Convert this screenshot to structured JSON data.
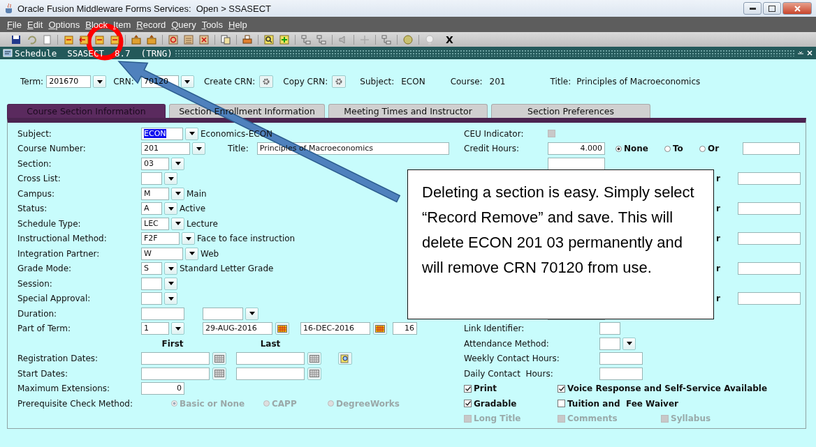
{
  "window": {
    "title": "Oracle Fusion Middleware Forms Services:  Open > SSASECT"
  },
  "menu": [
    {
      "label": "File"
    },
    {
      "label": "Edit"
    },
    {
      "label": "Options"
    },
    {
      "label": "Block"
    },
    {
      "label": "Item"
    },
    {
      "label": "Record"
    },
    {
      "label": "Query"
    },
    {
      "label": "Tools"
    },
    {
      "label": "Help"
    }
  ],
  "toolbar": {
    "close_label": "X"
  },
  "form": {
    "title": "Schedule  SSASECT  8.7  (TRNG)"
  },
  "key_block": {
    "term": {
      "label": "Term:",
      "value": "201670"
    },
    "crn": {
      "label": "CRN:",
      "value": "70120"
    },
    "create_crn": {
      "label": "Create CRN:"
    },
    "copy_crn": {
      "label": "Copy CRN:"
    },
    "subject": {
      "label": "Subject:",
      "value": "ECON"
    },
    "course": {
      "label": "Course:",
      "value": "201"
    },
    "title": {
      "label": "Title:",
      "value": "Principles of Macroeconomics"
    }
  },
  "tabs": [
    {
      "label": "Course Section Information",
      "selected": true
    },
    {
      "label": "Section Enrollment Information",
      "selected": false
    },
    {
      "label": "Meeting Times and Instructor",
      "selected": false
    },
    {
      "label": "Section Preferences",
      "selected": false
    }
  ],
  "left_rows": [
    {
      "kind": "select",
      "label": "Subject:",
      "value": "ECON",
      "value_selected": true,
      "description": "Economics-ECON"
    },
    {
      "kind": "course",
      "label": "Course Number:",
      "value": "201",
      "title_label": "Title:",
      "title_value": "Principles of Macroeconomics"
    },
    {
      "kind": "select",
      "label": "Section:",
      "value": "03"
    },
    {
      "kind": "select",
      "label": "Cross List:"
    },
    {
      "kind": "select",
      "label": "Campus:",
      "value": "M",
      "description": "Main"
    },
    {
      "kind": "select",
      "label": "Status:",
      "value": "A",
      "description": "Active"
    },
    {
      "kind": "select",
      "label": "Schedule Type:",
      "value": "LEC",
      "description": "Lecture"
    },
    {
      "kind": "select",
      "label": "Instructional Method:",
      "value": "F2F",
      "description": "Face to face instruction"
    },
    {
      "kind": "select",
      "label": "Integration Partner:",
      "value": "W",
      "description": "Web"
    },
    {
      "kind": "select",
      "label": "Grade Mode:",
      "value": "S",
      "description": "Standard Letter Grade"
    },
    {
      "kind": "select",
      "label": "Session:"
    },
    {
      "kind": "select",
      "label": "Special Approval:"
    },
    {
      "kind": "duration",
      "label": "Duration:"
    },
    {
      "kind": "term_part",
      "label": "Part of Term:",
      "value": "1",
      "start": "29-AUG-2016",
      "end": "16-DEC-2016",
      "weeks": "16"
    },
    {
      "kind": "header",
      "first": "First",
      "last": "Last"
    },
    {
      "kind": "dates",
      "label": "Registration Dates:",
      "lookup": true
    },
    {
      "kind": "dates",
      "label": "Start Dates:",
      "lookup": false
    },
    {
      "kind": "number",
      "label": "Maximum Extensions:",
      "value": "0"
    },
    {
      "kind": "radios",
      "label": "Prerequisite Check Method:",
      "options": [
        {
          "label": "Basic or None",
          "selected": true,
          "disabled": true
        },
        {
          "label": "CAPP",
          "selected": false,
          "disabled": true
        },
        {
          "label": "DegreeWorks",
          "selected": false,
          "disabled": true
        }
      ]
    }
  ],
  "right_rows": [
    {
      "kind": "checkbox",
      "label": "CEU Indicator:",
      "checked": false,
      "disabled": true
    },
    {
      "kind": "credit",
      "label": "Credit Hours:",
      "value": "4.000",
      "options": [
        {
          "label": "None",
          "selected": true
        },
        {
          "label": "To",
          "selected": false
        },
        {
          "label": "Or",
          "selected": false
        }
      ]
    },
    {
      "kind": "field"
    },
    {
      "kind": "or_field",
      "label": "r"
    },
    {
      "kind": "or_field",
      "label": "r"
    },
    {
      "kind": "or_field",
      "label": "r"
    },
    {
      "kind": "or_field",
      "label": "r"
    },
    {
      "kind": "or_field",
      "label": "r"
    },
    {
      "kind": "field"
    },
    {
      "kind": "input",
      "label": "Link Identifier:"
    },
    {
      "kind": "select",
      "label": "Attendance Method:"
    },
    {
      "kind": "input",
      "label": "Weekly Contact Hours:"
    },
    {
      "kind": "input",
      "label": "Daily Contact  Hours:"
    },
    {
      "kind": "checks",
      "items": [
        {
          "label": "Print",
          "checked": true,
          "disabled": false
        },
        {
          "label": "Voice Response and Self-Service Available",
          "checked": true,
          "disabled": false
        }
      ]
    },
    {
      "kind": "checks",
      "items": [
        {
          "label": "Gradable",
          "checked": true,
          "disabled": false
        },
        {
          "label": "Tuition and  Fee Waiver",
          "checked": false,
          "disabled": false
        }
      ]
    },
    {
      "kind": "checks",
      "items": [
        {
          "label": "Long Title",
          "checked": false,
          "disabled": true
        },
        {
          "label": "Comments",
          "checked": false,
          "disabled": true
        },
        {
          "label": "Syllabus",
          "checked": false,
          "disabled": true
        }
      ]
    }
  ],
  "callout": {
    "text": "Deleting a section is easy. Simply select “Record Remove” and save. This will delete ECON 201 03 permanently and will remove CRN 70120 from use."
  }
}
